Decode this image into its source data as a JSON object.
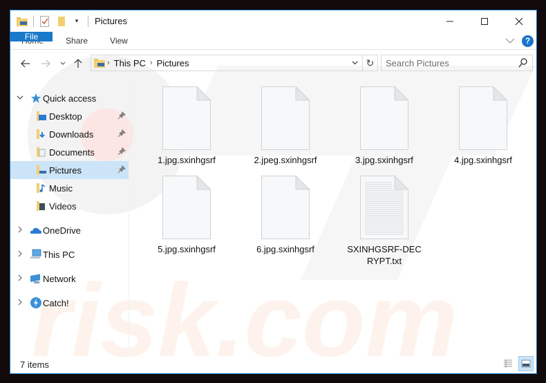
{
  "window": {
    "title": "Pictures",
    "controls": {
      "minimize": "—",
      "maximize": "☐",
      "close": "✕"
    }
  },
  "ribbon": {
    "tabs": [
      "File",
      "Home",
      "Share",
      "View"
    ],
    "help": "?"
  },
  "navigation": {
    "breadcrumb": [
      "This PC",
      "Pictures"
    ],
    "search_placeholder": "Search Pictures"
  },
  "sidebar": {
    "quick_access": {
      "label": "Quick access",
      "items": [
        {
          "label": "Desktop",
          "icon": "desktop-folder-icon",
          "pinned": true
        },
        {
          "label": "Downloads",
          "icon": "downloads-folder-icon",
          "pinned": true
        },
        {
          "label": "Documents",
          "icon": "documents-folder-icon",
          "pinned": true
        },
        {
          "label": "Pictures",
          "icon": "pictures-folder-icon",
          "pinned": true,
          "selected": true
        },
        {
          "label": "Music",
          "icon": "music-folder-icon",
          "pinned": false
        },
        {
          "label": "Videos",
          "icon": "videos-folder-icon",
          "pinned": false
        }
      ]
    },
    "roots": [
      {
        "label": "OneDrive",
        "icon": "onedrive-icon"
      },
      {
        "label": "This PC",
        "icon": "this-pc-icon"
      },
      {
        "label": "Network",
        "icon": "network-icon"
      },
      {
        "label": "Catch!",
        "icon": "catch-icon"
      }
    ]
  },
  "files": [
    {
      "name": "1.jpg.sxinhgsrf",
      "type": "blank"
    },
    {
      "name": "2.jpeg.sxinhgsrf",
      "type": "blank"
    },
    {
      "name": "3.jpg.sxinhgsrf",
      "type": "blank"
    },
    {
      "name": "4.jpg.sxinhgsrf",
      "type": "blank"
    },
    {
      "name": "5.jpg.sxinhgsrf",
      "type": "blank"
    },
    {
      "name": "6.jpg.sxinhgsrf",
      "type": "blank"
    },
    {
      "name": "SXINHGSRF-DECRYPT.txt",
      "type": "text"
    }
  ],
  "status": {
    "item_count": "7 items"
  },
  "colors": {
    "accent": "#1979ca",
    "selection": "#cce4f7"
  }
}
